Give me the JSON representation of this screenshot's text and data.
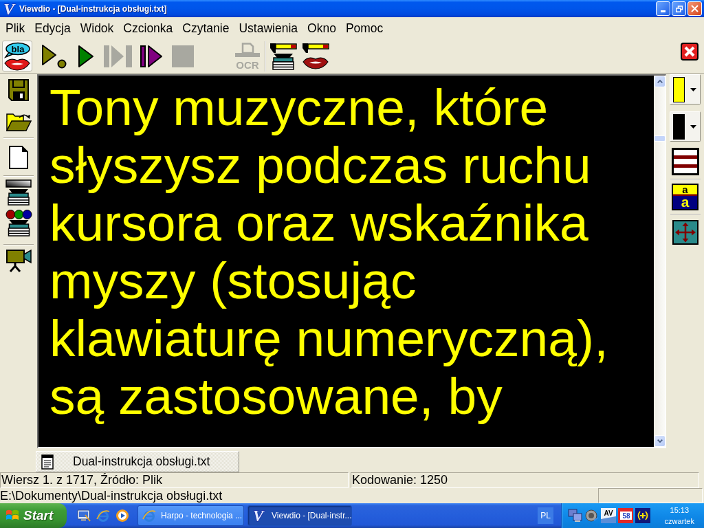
{
  "window": {
    "logo": "V",
    "title": "Viewdio - [Dual-instrukcja obsługi.txt]"
  },
  "menu": [
    "Plik",
    "Edycja",
    "Widok",
    "Czcionka",
    "Czytanie",
    "Ustawienia",
    "Okno",
    "Pomoc"
  ],
  "toolbar": [
    {
      "kind": "speak",
      "label": "bla",
      "checked": true,
      "disabled": false
    },
    {
      "kind": "resume",
      "checked": false,
      "disabled": false
    },
    {
      "kind": "play",
      "checked": false,
      "disabled": false
    },
    {
      "kind": "skip",
      "checked": false,
      "disabled": true
    },
    {
      "kind": "step",
      "checked": false,
      "disabled": false
    },
    {
      "kind": "stop",
      "checked": false,
      "disabled": true
    },
    {
      "kind": "ocr",
      "label": "OCR",
      "checked": false,
      "disabled": true
    },
    {
      "kind": "divider"
    },
    {
      "kind": "scanner",
      "checked": false,
      "disabled": false
    },
    {
      "kind": "voice",
      "checked": false,
      "disabled": false
    }
  ],
  "left_toolbar": [
    {
      "kind": "save"
    },
    {
      "kind": "open"
    },
    {
      "kind": "divider"
    },
    {
      "kind": "new"
    },
    {
      "kind": "divider"
    },
    {
      "kind": "scangray"
    },
    {
      "kind": "scancolor"
    },
    {
      "kind": "divider"
    },
    {
      "kind": "camera"
    }
  ],
  "right_toolbar": [
    {
      "kind": "color",
      "color": "#ffff00"
    },
    {
      "kind": "color",
      "color": "#000000"
    },
    {
      "kind": "spacing"
    },
    {
      "kind": "divider"
    },
    {
      "kind": "fontsize",
      "labels": [
        "a",
        "a"
      ]
    },
    {
      "kind": "divider"
    },
    {
      "kind": "move"
    }
  ],
  "document": {
    "text": "Tony muzyczne, które słyszysz podczas ruchu kursora oraz wskaźnika myszy (stosując klawiaturę numeryczną), są zastosowane, by"
  },
  "document_tabs": [
    {
      "label": "Dual-instrukcja obsługi.txt",
      "selected": true
    }
  ],
  "status_bar": {
    "panels": [
      "Wiersz 1. z 1717, Źródło: Plik",
      "Kodowanie: 1250"
    ],
    "path": "E:\\Dokumenty\\Dual-instrukcja obsługi.txt"
  },
  "taskbar": {
    "start": "Start",
    "quick_launch": [
      {
        "kind": "desktop"
      },
      {
        "kind": "browser"
      },
      {
        "kind": "media"
      }
    ],
    "tasks": [
      {
        "kind": "browser",
        "label": "Harpo - technologia ...",
        "selected": false
      },
      {
        "kind": "app",
        "logo": "V",
        "label": "Viewdio - [Dual-instr...",
        "selected": true
      }
    ],
    "language": "PL",
    "tray": [
      {
        "kind": "network"
      },
      {
        "kind": "speaker"
      },
      {
        "kind": "antivirus",
        "label": "AV"
      },
      {
        "kind": "counter",
        "label": "58"
      },
      {
        "kind": "broadcast"
      }
    ],
    "clock": {
      "time": "15:13",
      "day": "czwartek"
    }
  }
}
